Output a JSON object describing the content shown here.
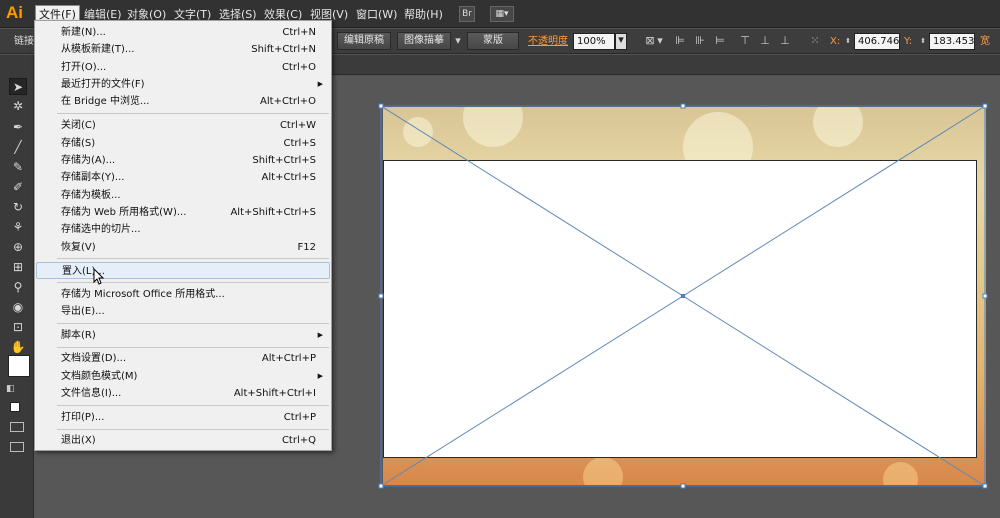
{
  "app": {
    "logo": "Ai"
  },
  "menubar": {
    "items": [
      "文件(F)",
      "编辑(E)",
      "对象(O)",
      "文字(T)",
      "选择(S)",
      "效果(C)",
      "视图(V)",
      "窗口(W)",
      "帮助(H)"
    ],
    "active_index": 0,
    "bridge_btn": "Br"
  },
  "controlbar": {
    "left_label": "链接",
    "edit_original": "编辑原稿",
    "image_trace": "图像描摹",
    "mask": "蒙版",
    "opacity_label": "不透明度",
    "opacity_value": "100%",
    "x_value": "406.746",
    "y_value": "183.453",
    "x_label": "X:",
    "y_label": "Y:",
    "w_label": "宽"
  },
  "file_menu": {
    "items": [
      {
        "label": "新建(N)...",
        "shortcut": "Ctrl+N"
      },
      {
        "label": "从模板新建(T)...",
        "shortcut": "Shift+Ctrl+N"
      },
      {
        "label": "打开(O)...",
        "shortcut": "Ctrl+O"
      },
      {
        "label": "最近打开的文件(F)",
        "shortcut": "",
        "submenu": true
      },
      {
        "label": "在 Bridge 中浏览...",
        "shortcut": "Alt+Ctrl+O"
      },
      {
        "label": "关闭(C)",
        "shortcut": "Ctrl+W"
      },
      {
        "label": "存储(S)",
        "shortcut": "Ctrl+S"
      },
      {
        "label": "存储为(A)...",
        "shortcut": "Shift+Ctrl+S"
      },
      {
        "label": "存储副本(Y)...",
        "shortcut": "Alt+Ctrl+S"
      },
      {
        "label": "存储为模板...",
        "shortcut": ""
      },
      {
        "label": "存储为 Web 所用格式(W)...",
        "shortcut": "Alt+Shift+Ctrl+S"
      },
      {
        "label": "存储选中的切片...",
        "shortcut": ""
      },
      {
        "label": "恢复(V)",
        "shortcut": "F12"
      },
      {
        "label": "置入(L)...",
        "shortcut": "",
        "hover": true
      },
      {
        "label": "存储为 Microsoft Office 所用格式...",
        "shortcut": ""
      },
      {
        "label": "导出(E)...",
        "shortcut": ""
      },
      {
        "label": "脚本(R)",
        "shortcut": "",
        "submenu": true
      },
      {
        "label": "文档设置(D)...",
        "shortcut": "Alt+Ctrl+P"
      },
      {
        "label": "文档颜色模式(M)",
        "shortcut": "",
        "submenu": true
      },
      {
        "label": "文件信息(I)...",
        "shortcut": "Alt+Shift+Ctrl+I"
      },
      {
        "label": "打印(P)...",
        "shortcut": "Ctrl+P"
      },
      {
        "label": "退出(X)",
        "shortcut": "Ctrl+Q"
      }
    ]
  },
  "tools": [
    "selection-tool",
    "magic-wand-tool",
    "pen-tool",
    "line-tool",
    "paintbrush-tool",
    "blob-brush-tool",
    "rotate-tool",
    "warp-tool",
    "shape-builder-tool",
    "mesh-tool",
    "eyedropper-tool",
    "symbol-sprayer-tool",
    "artboard-tool",
    "hand-tool"
  ]
}
